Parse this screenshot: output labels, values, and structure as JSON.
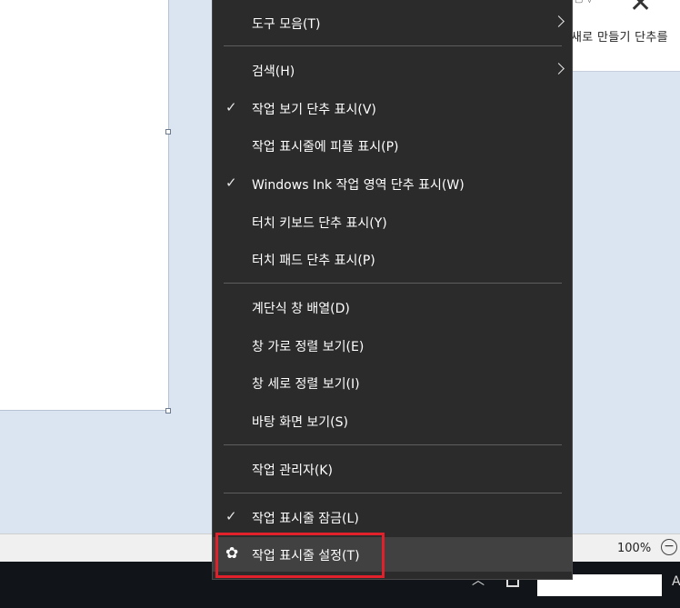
{
  "background": {
    "panel_caption": "새로 만들기 단추를",
    "panel_top_fragment": "▢ ▽",
    "zoom_level": "100%",
    "zoom_out_symbol": "−"
  },
  "menu": {
    "items": [
      {
        "label": "도구 모음(T)",
        "checked": false,
        "submenu": true
      },
      {
        "label": "검색(H)",
        "checked": false,
        "submenu": true
      },
      {
        "label": "작업 보기 단추 표시(V)",
        "checked": true
      },
      {
        "label": "작업 표시줄에 피플 표시(P)",
        "checked": false
      },
      {
        "label": "Windows Ink 작업 영역 단추 표시(W)",
        "checked": true
      },
      {
        "label": "터치 키보드 단추 표시(Y)",
        "checked": false
      },
      {
        "label": "터치 패드 단추 표시(P)",
        "checked": false
      },
      {
        "label": "계단식 창 배열(D)",
        "checked": false
      },
      {
        "label": "창 가로 정렬 보기(E)",
        "checked": false
      },
      {
        "label": "창 세로 정렬 보기(I)",
        "checked": false
      },
      {
        "label": "바탕 화면 보기(S)",
        "checked": false
      },
      {
        "label": "작업 관리자(K)",
        "checked": false
      },
      {
        "label": "작업 표시줄 잠금(L)",
        "checked": true
      },
      {
        "label": "작업 표시줄 설정(T)",
        "checked": false,
        "hovered": true
      }
    ],
    "check_glyph": "✓",
    "gear_glyph": "✿"
  },
  "taskbar": {
    "chevron_glyph": "︿",
    "extra_glyph": "A"
  },
  "colors": {
    "menu_bg": "#2b2b2b",
    "menu_hover": "#414141",
    "highlight_border": "#e0202a",
    "taskbar_bg": "#111418"
  }
}
